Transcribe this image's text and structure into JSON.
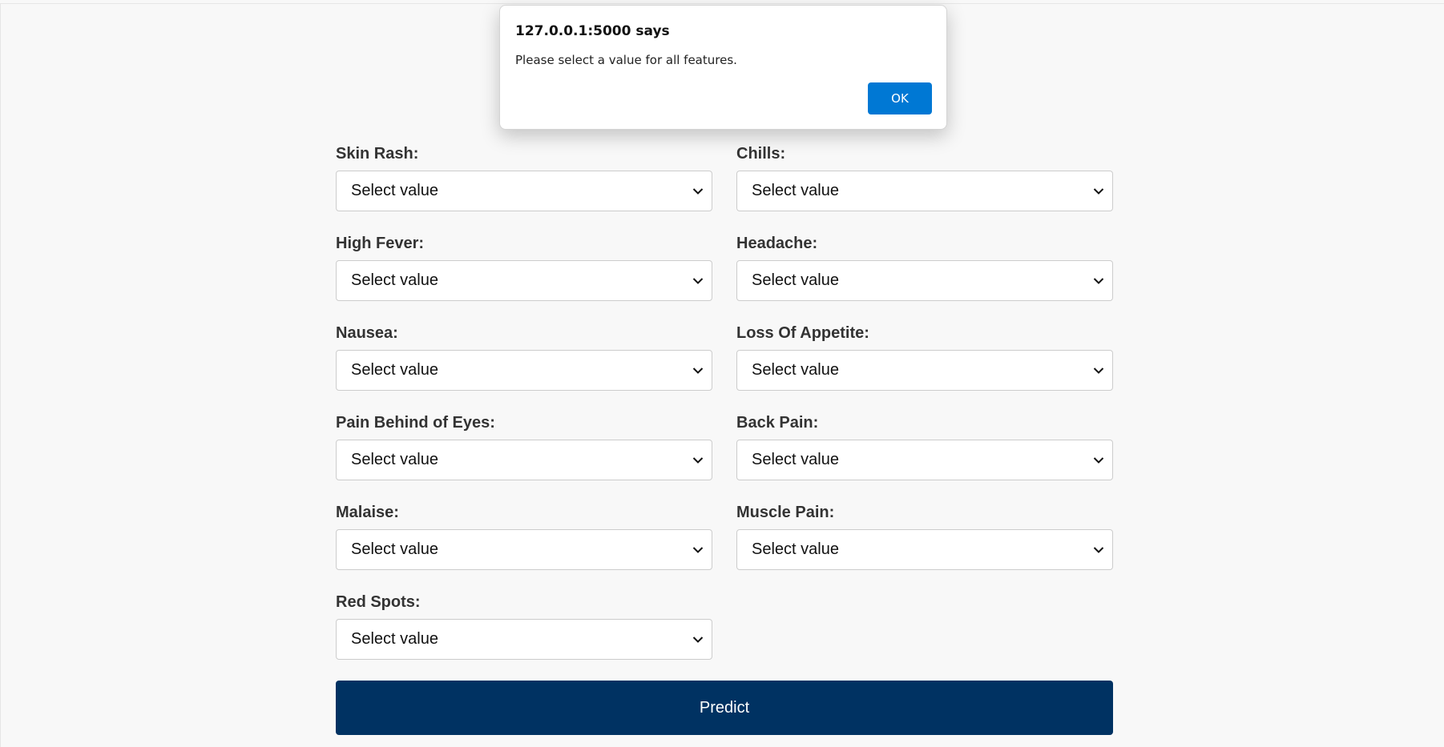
{
  "form": {
    "fields": [
      {
        "label": "Skin Rash:",
        "value": "Select value"
      },
      {
        "label": "Chills:",
        "value": "Select value"
      },
      {
        "label": "High Fever:",
        "value": "Select value"
      },
      {
        "label": "Headache:",
        "value": "Select value"
      },
      {
        "label": "Nausea:",
        "value": "Select value"
      },
      {
        "label": "Loss Of Appetite:",
        "value": "Select value"
      },
      {
        "label": "Pain Behind of Eyes:",
        "value": "Select value"
      },
      {
        "label": "Back Pain:",
        "value": "Select value"
      },
      {
        "label": "Malaise:",
        "value": "Select value"
      },
      {
        "label": "Muscle Pain:",
        "value": "Select value"
      },
      {
        "label": "Red Spots:",
        "value": "Select value"
      }
    ],
    "submit_label": "Predict"
  },
  "dialog": {
    "title": "127.0.0.1:5000 says",
    "message": "Please select a value for all features.",
    "ok_label": "OK"
  },
  "colors": {
    "background": "#f8f8f8",
    "button": "#003262",
    "dialog_ok": "#0078d4"
  },
  "icons": {
    "select_arrow": "chevron-down-icon"
  }
}
